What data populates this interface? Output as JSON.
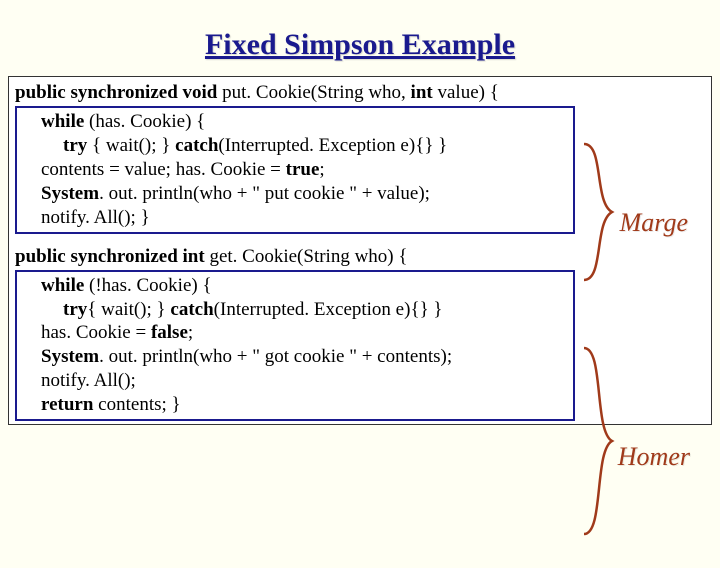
{
  "title": "Fixed Simpson Example",
  "annotations": {
    "marge": "Marge",
    "homer": "Homer"
  },
  "code": {
    "put": {
      "sig1_pre": "public synchronized void",
      "sig1_mid": " put. Cookie(String who, ",
      "sig1_int": "int",
      "sig1_post": " value) {",
      "line2_kw": "while",
      "line2_rest": " (has. Cookie) {",
      "line3_try": "try",
      "line3_mid": " { wait(); }  ",
      "line3_catch": "catch",
      "line3_rest": "(Interrupted. Exception e){} }",
      "line4_pre": "contents = value; has. Cookie = ",
      "line4_true": "true",
      "line4_post": ";",
      "line5_sys": "System",
      "line5_rest": ". out. println(who + \" put cookie \" + value);",
      "line6": "notify. All(); }"
    },
    "get": {
      "sig1_pre": "public synchronized int",
      "sig1_mid": " get. Cookie(String who) {",
      "line2_kw": "while",
      "line2_rest": " (!has. Cookie) {",
      "line3_try": "try",
      "line3_mid": "{ wait(); }  ",
      "line3_catch": "catch",
      "line3_rest": "(Interrupted. Exception e){} }",
      "line4_pre": "has. Cookie = ",
      "line4_false": "false",
      "line4_post": ";",
      "line5_sys": "System",
      "line5_rest": ". out. println(who + \" got cookie \" + contents);",
      "line6": "notify. All();",
      "line7_kw": "return",
      "line7_rest": " contents; }"
    }
  }
}
